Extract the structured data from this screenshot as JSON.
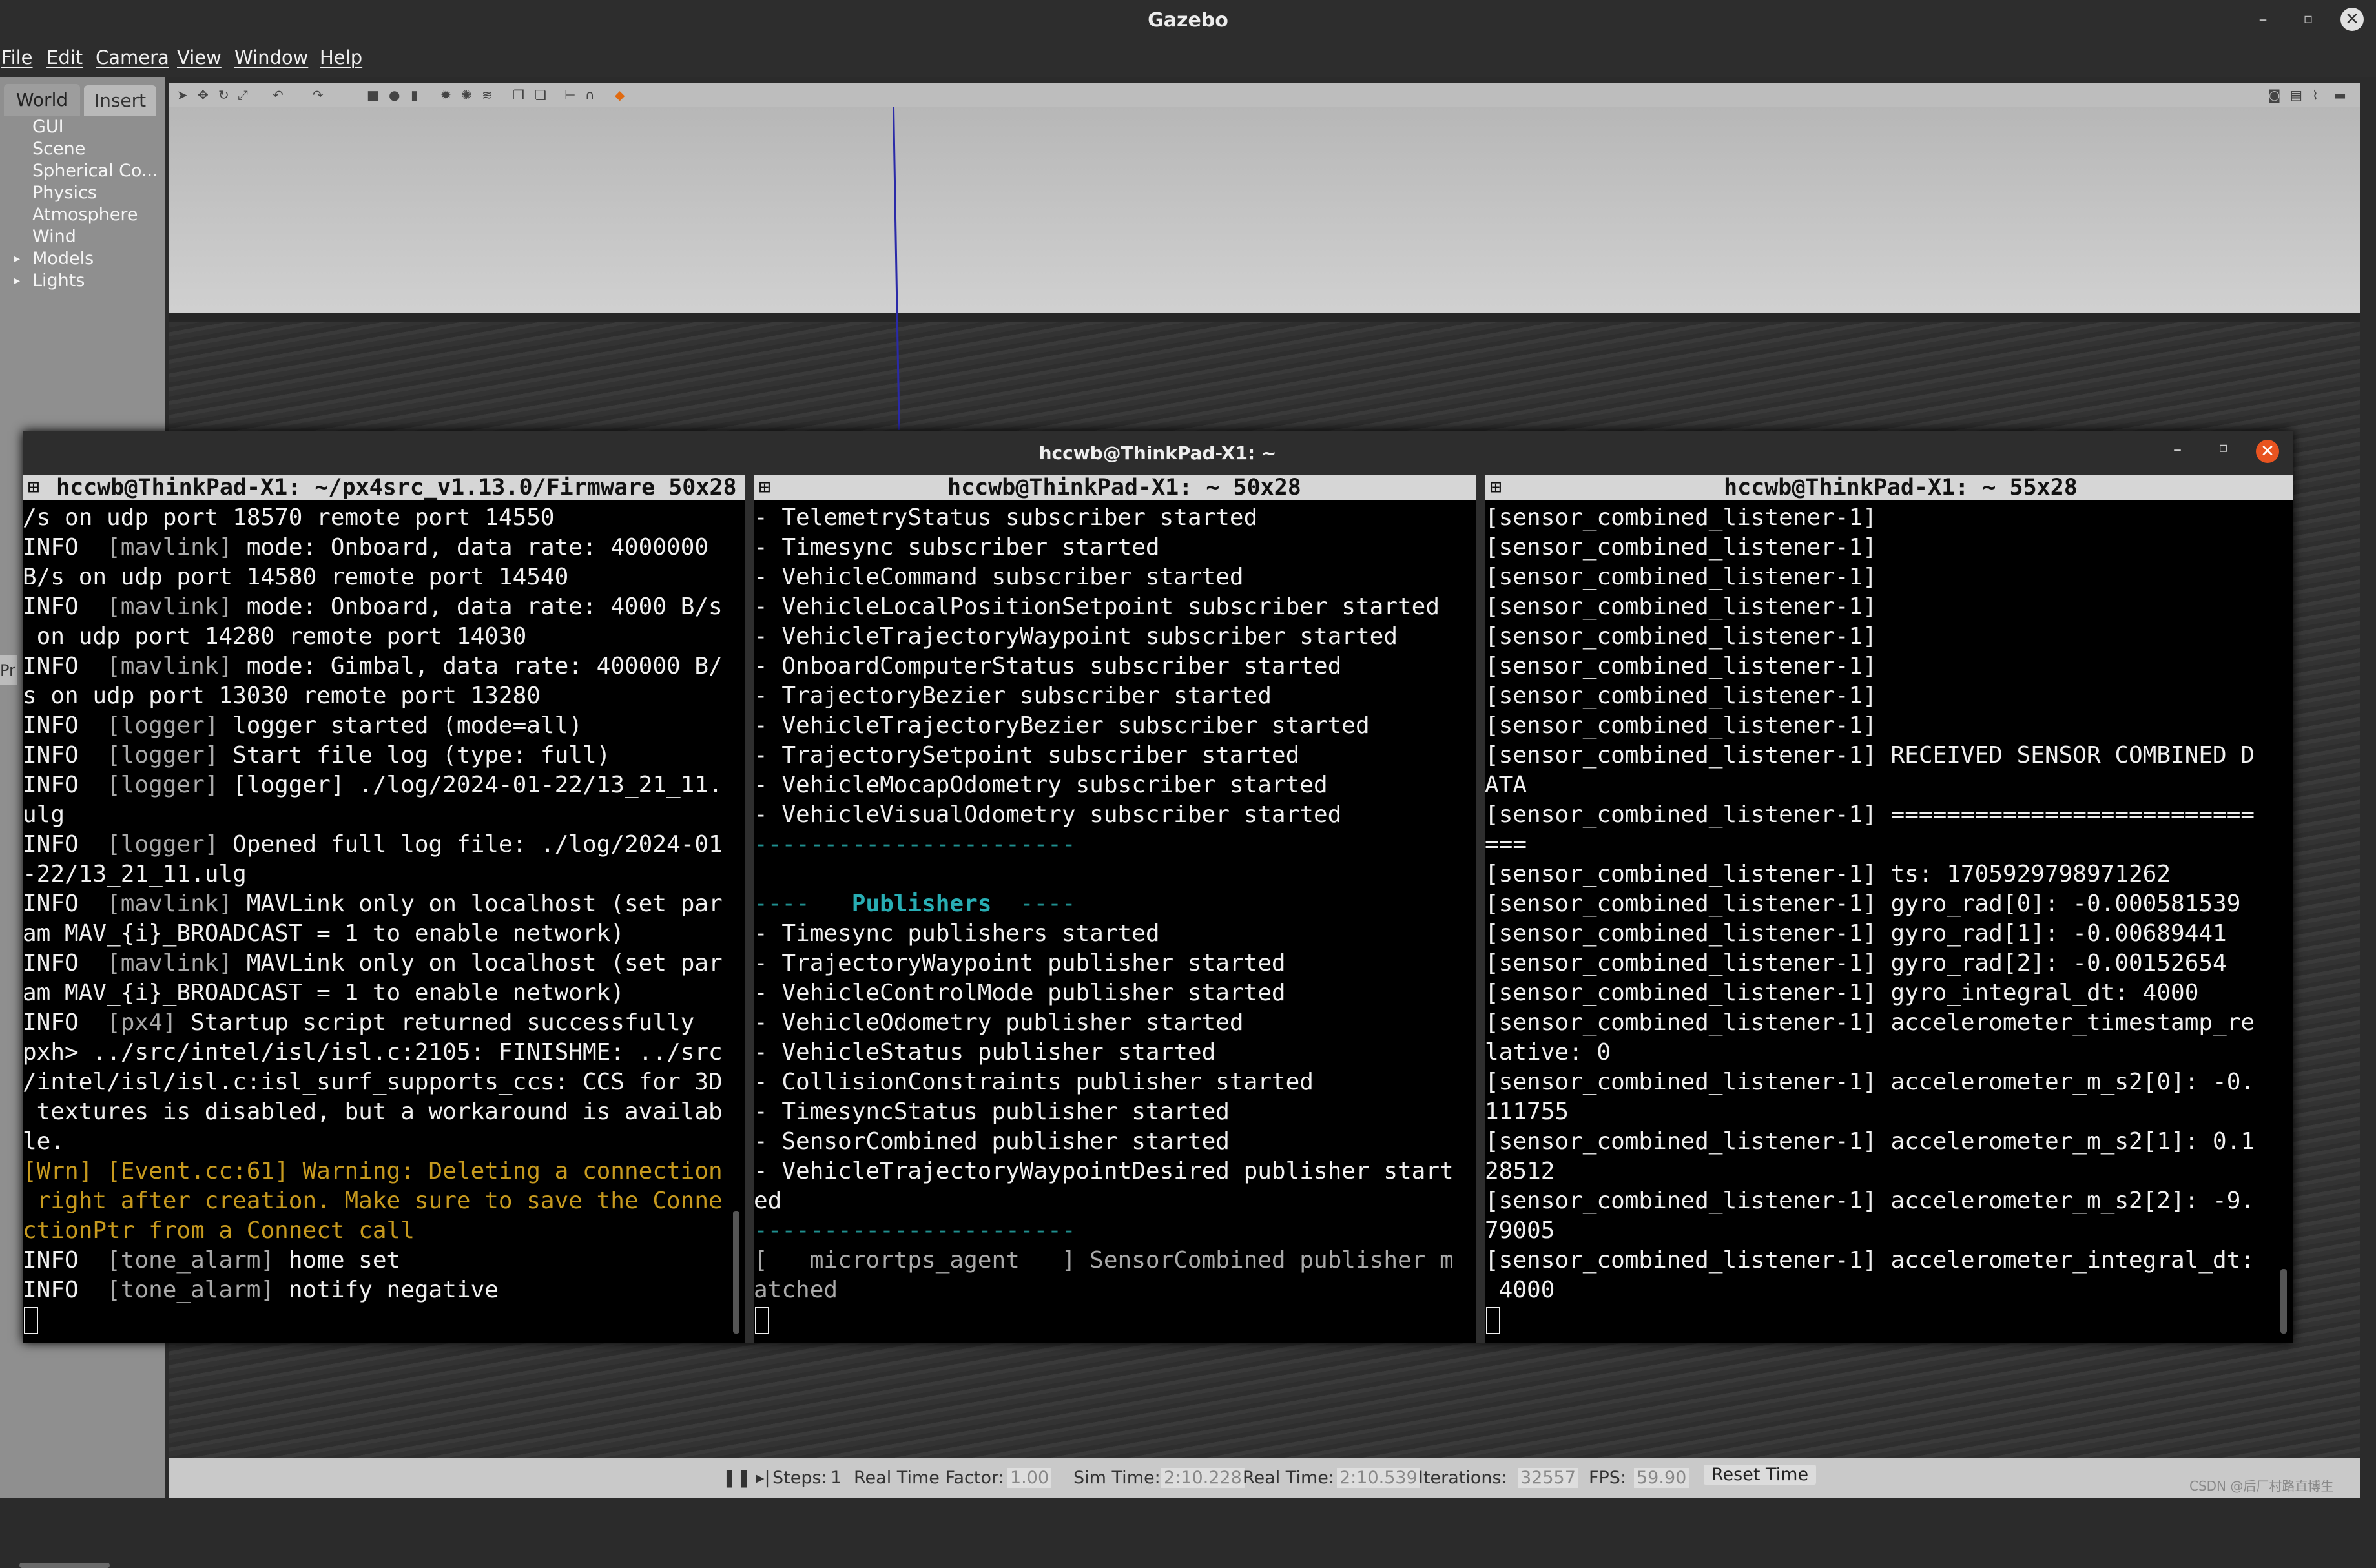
{
  "window": {
    "title": "Gazebo"
  },
  "menu": [
    "File",
    "Edit",
    "Camera",
    "View",
    "Window",
    "Help"
  ],
  "left_panel": {
    "tabs": [
      "World",
      "Insert"
    ],
    "tree": [
      {
        "label": "GUI",
        "expandable": false
      },
      {
        "label": "Scene",
        "expandable": false
      },
      {
        "label": "Spherical Co...",
        "expandable": false
      },
      {
        "label": "Physics",
        "expandable": false
      },
      {
        "label": "Atmosphere",
        "expandable": false
      },
      {
        "label": "Wind",
        "expandable": false
      },
      {
        "label": "Models",
        "expandable": true
      },
      {
        "label": "Lights",
        "expandable": true
      }
    ],
    "collapsed_tab": "Pr"
  },
  "status": {
    "steps_label": "Steps:",
    "steps_value": "1",
    "rtf_label": "Real Time Factor:",
    "rtf_value": "1.00",
    "sim_label": "Sim Time:",
    "sim_value": "2:10.228",
    "real_label": "Real Time:",
    "real_value": "2:10.539",
    "iter_label": "Iterations:",
    "iter_value": "32557",
    "fps_label": "FPS:",
    "fps_value": "59.90",
    "reset_label": "Reset Time",
    "watermark": "CSDN @后厂村路直博生"
  },
  "terminal": {
    "title": "hccwb@ThinkPad-X1: ~",
    "panes": [
      {
        "header": "hccwb@ThinkPad-X1: ~/px4src_v1.13.0/Firmware 50x28",
        "lines": [
          {
            "text": "/s on udp port 18570 remote port 14550"
          },
          {
            "prefix": "INFO  ",
            "tag": "[mavlink]",
            "text": " mode: Onboard, data rate: 4000000"
          },
          {
            "text": "B/s on udp port 14580 remote port 14540"
          },
          {
            "prefix": "INFO  ",
            "tag": "[mavlink]",
            "text": " mode: Onboard, data rate: 4000 B/s"
          },
          {
            "text": " on udp port 14280 remote port 14030"
          },
          {
            "prefix": "INFO  ",
            "tag": "[mavlink]",
            "text": " mode: Gimbal, data rate: 400000 B/"
          },
          {
            "text": "s on udp port 13030 remote port 13280"
          },
          {
            "prefix": "INFO  ",
            "tag": "[logger]",
            "text": " logger started (mode=all)"
          },
          {
            "prefix": "INFO  ",
            "tag": "[logger]",
            "text": " Start file log (type: full)"
          },
          {
            "prefix": "INFO  ",
            "tag": "[logger]",
            "text": " [logger] ./log/2024-01-22/13_21_11."
          },
          {
            "text": "ulg"
          },
          {
            "prefix": "INFO  ",
            "tag": "[logger]",
            "text": " Opened full log file: ./log/2024-01"
          },
          {
            "text": "-22/13_21_11.ulg"
          },
          {
            "prefix": "INFO  ",
            "tag": "[mavlink]",
            "text": " MAVLink only on localhost (set par"
          },
          {
            "text": "am MAV_{i}_BROADCAST = 1 to enable network)"
          },
          {
            "prefix": "INFO  ",
            "tag": "[mavlink]",
            "text": " MAVLink only on localhost (set par"
          },
          {
            "text": "am MAV_{i}_BROADCAST = 1 to enable network)"
          },
          {
            "prefix": "INFO  ",
            "tag": "[px4]",
            "text": " Startup script returned successfully"
          },
          {
            "text": "pxh> ../src/intel/isl/isl.c:2105: FINISHME: ../src"
          },
          {
            "text": "/intel/isl/isl.c:isl_surf_supports_ccs: CCS for 3D"
          },
          {
            "text": " textures is disabled, but a workaround is availab"
          },
          {
            "text": "le."
          },
          {
            "warn": true,
            "text": "[Wrn] [Event.cc:61] Warning: Deleting a connection"
          },
          {
            "warn": true,
            "text": " right after creation. Make sure to save the Conne"
          },
          {
            "warn": true,
            "text": "ctionPtr from a Connect call"
          },
          {
            "prefix": "INFO  ",
            "tag": "[tone_alarm]",
            "text": " home set"
          },
          {
            "prefix": "INFO  ",
            "tag": "[tone_alarm]",
            "text": " notify negative"
          },
          {
            "cursor": true,
            "text": ""
          }
        ]
      },
      {
        "header": "hccwb@ThinkPad-X1: ~ 50x28",
        "lines": [
          {
            "text": "- TelemetryStatus subscriber started"
          },
          {
            "text": "- Timesync subscriber started"
          },
          {
            "text": "- VehicleCommand subscriber started"
          },
          {
            "text": "- VehicleLocalPositionSetpoint subscriber started"
          },
          {
            "text": "- VehicleTrajectoryWaypoint subscriber started"
          },
          {
            "text": "- OnboardComputerStatus subscriber started"
          },
          {
            "text": "- TrajectoryBezier subscriber started"
          },
          {
            "text": "- VehicleTrajectoryBezier subscriber started"
          },
          {
            "text": "- TrajectorySetpoint subscriber started"
          },
          {
            "text": "- VehicleMocapOdometry subscriber started"
          },
          {
            "text": "- VehicleVisualOdometry subscriber started"
          },
          {
            "dash": true,
            "text": "-----------------------"
          },
          {
            "text": ""
          },
          {
            "pub": true,
            "pre": "----   ",
            "bold": "Publishers",
            "post": "  ----"
          },
          {
            "text": "- Timesync publishers started"
          },
          {
            "text": "- TrajectoryWaypoint publisher started"
          },
          {
            "text": "- VehicleControlMode publisher started"
          },
          {
            "text": "- VehicleOdometry publisher started"
          },
          {
            "text": "- VehicleStatus publisher started"
          },
          {
            "text": "- CollisionConstraints publisher started"
          },
          {
            "text": "- TimesyncStatus publisher started"
          },
          {
            "text": "- SensorCombined publisher started"
          },
          {
            "text": "- VehicleTrajectoryWaypointDesired publisher start"
          },
          {
            "text": "ed"
          },
          {
            "dash": true,
            "text": "-----------------------"
          },
          {
            "agent": true,
            "text": "[   micrortps_agent   ] SensorCombined publisher m"
          },
          {
            "agent": true,
            "text": "atched"
          },
          {
            "cursor": true,
            "text": ""
          }
        ]
      },
      {
        "header": "hccwb@ThinkPad-X1: ~ 55x28",
        "lines": [
          {
            "text": "[sensor_combined_listener-1]"
          },
          {
            "text": "[sensor_combined_listener-1]"
          },
          {
            "text": "[sensor_combined_listener-1]"
          },
          {
            "text": "[sensor_combined_listener-1]"
          },
          {
            "text": "[sensor_combined_listener-1]"
          },
          {
            "text": "[sensor_combined_listener-1]"
          },
          {
            "text": "[sensor_combined_listener-1]"
          },
          {
            "text": "[sensor_combined_listener-1]"
          },
          {
            "text": "[sensor_combined_listener-1] RECEIVED SENSOR COMBINED D"
          },
          {
            "text": "ATA"
          },
          {
            "text": "[sensor_combined_listener-1] =========================="
          },
          {
            "text": "==="
          },
          {
            "text": "[sensor_combined_listener-1] ts: 1705929798971262"
          },
          {
            "text": "[sensor_combined_listener-1] gyro_rad[0]: -0.000581539"
          },
          {
            "text": "[sensor_combined_listener-1] gyro_rad[1]: -0.00689441"
          },
          {
            "text": "[sensor_combined_listener-1] gyro_rad[2]: -0.00152654"
          },
          {
            "text": "[sensor_combined_listener-1] gyro_integral_dt: 4000"
          },
          {
            "text": "[sensor_combined_listener-1] accelerometer_timestamp_re"
          },
          {
            "text": "lative: 0"
          },
          {
            "text": "[sensor_combined_listener-1] accelerometer_m_s2[0]: -0."
          },
          {
            "text": "111755"
          },
          {
            "text": "[sensor_combined_listener-1] accelerometer_m_s2[1]: 0.1"
          },
          {
            "text": "28512"
          },
          {
            "text": "[sensor_combined_listener-1] accelerometer_m_s2[2]: -9."
          },
          {
            "text": "79005"
          },
          {
            "text": "[sensor_combined_listener-1] accelerometer_integral_dt:"
          },
          {
            "text": " 4000"
          },
          {
            "cursor": true,
            "text": ""
          }
        ]
      }
    ]
  }
}
